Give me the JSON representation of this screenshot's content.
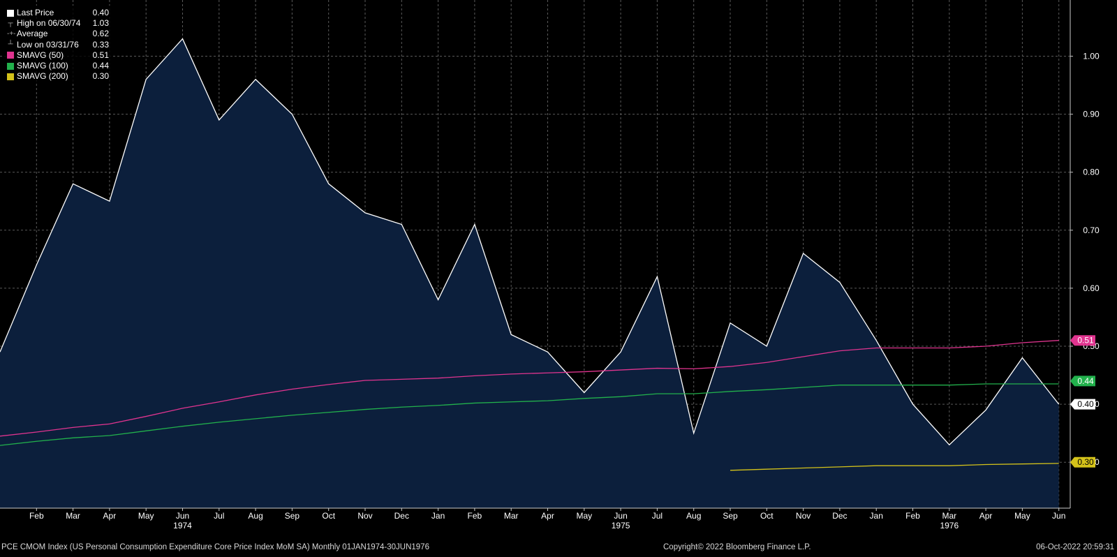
{
  "chart_data": {
    "type": "area",
    "title": "",
    "xlabel": "",
    "ylabel": "",
    "ylim": [
      0.2,
      1.1
    ],
    "yticks": [
      "1.00",
      "0.90",
      "0.80",
      "0.70",
      "0.60",
      "0.50",
      "0.40",
      "0.30"
    ],
    "grid": true,
    "legend_placement": "top-left",
    "x": [
      "1974-01",
      "1974-02",
      "1974-03",
      "1974-04",
      "1974-05",
      "1974-06",
      "1974-07",
      "1974-08",
      "1974-09",
      "1974-10",
      "1974-11",
      "1974-12",
      "1975-01",
      "1975-02",
      "1975-03",
      "1975-04",
      "1975-05",
      "1975-06",
      "1975-07",
      "1975-08",
      "1975-09",
      "1975-10",
      "1975-11",
      "1975-12",
      "1976-01",
      "1976-02",
      "1976-03",
      "1976-04",
      "1976-05",
      "1976-06"
    ],
    "month_labels": [
      "Feb",
      "Mar",
      "Apr",
      "May",
      "Jun",
      "Jul",
      "Aug",
      "Sep",
      "Oct",
      "Nov",
      "Dec",
      "Jan",
      "Feb",
      "Mar",
      "Apr",
      "May",
      "Jun",
      "Jul",
      "Aug",
      "Sep",
      "Oct",
      "Nov",
      "Dec",
      "Jan",
      "Feb",
      "Mar",
      "Apr",
      "May",
      "Jun"
    ],
    "year_labels": [
      {
        "label": "1974",
        "under_month": "1974-06"
      },
      {
        "label": "1975",
        "under_month": "1975-06"
      },
      {
        "label": "1976",
        "under_month": "1976-03"
      }
    ],
    "series": [
      {
        "name": "Last Price",
        "style": "area",
        "color": "#ffffff",
        "fill": "#0c1f3c",
        "values": [
          0.49,
          0.64,
          0.78,
          0.75,
          0.96,
          1.03,
          0.89,
          0.96,
          0.9,
          0.78,
          0.73,
          0.71,
          0.58,
          0.71,
          0.52,
          0.49,
          0.42,
          0.49,
          0.62,
          0.35,
          0.54,
          0.5,
          0.66,
          0.61,
          0.51,
          0.4,
          0.33,
          0.39,
          0.48,
          0.4
        ]
      },
      {
        "name": "SMAVG (50)",
        "style": "line",
        "color": "#e0348f",
        "values": [
          0.345,
          0.352,
          0.36,
          0.366,
          0.379,
          0.393,
          0.404,
          0.416,
          0.426,
          0.434,
          0.441,
          0.443,
          0.445,
          0.449,
          0.452,
          0.454,
          0.456,
          0.459,
          0.462,
          0.461,
          0.465,
          0.472,
          0.482,
          0.492,
          0.497,
          0.497,
          0.497,
          0.5,
          0.506,
          0.51
        ]
      },
      {
        "name": "SMAVG (100)",
        "style": "line",
        "color": "#22b14c",
        "values": [
          0.329,
          0.336,
          0.342,
          0.346,
          0.354,
          0.362,
          0.369,
          0.375,
          0.381,
          0.386,
          0.391,
          0.395,
          0.398,
          0.402,
          0.404,
          0.406,
          0.41,
          0.413,
          0.418,
          0.418,
          0.422,
          0.425,
          0.429,
          0.433,
          0.433,
          0.433,
          0.433,
          0.435,
          0.435,
          0.435
        ]
      },
      {
        "name": "SMAVG (200)",
        "style": "line",
        "color": "#d4c21a",
        "values": [
          null,
          null,
          null,
          null,
          null,
          null,
          null,
          null,
          null,
          null,
          null,
          null,
          null,
          null,
          null,
          null,
          null,
          null,
          null,
          null,
          0.286,
          0.288,
          0.29,
          0.292,
          0.294,
          0.294,
          0.294,
          0.296,
          0.297,
          0.298
        ]
      }
    ],
    "axis_badges": [
      {
        "label": "0.51",
        "color": "#e0348f",
        "text_color": "#ffffff",
        "value": 0.51
      },
      {
        "label": "0.44",
        "color": "#22b14c",
        "text_color": "#ffffff",
        "value": 0.44
      },
      {
        "label": "0.40",
        "color": "#ffffff",
        "text_color": "#000000",
        "value": 0.4
      },
      {
        "label": "0.30",
        "color": "#d4c21a",
        "text_color": "#000000",
        "value": 0.3
      }
    ]
  },
  "legend": {
    "items": [
      {
        "label": "Last Price",
        "value": "0.40",
        "marker": "square",
        "color": "#ffffff"
      },
      {
        "label": "High on 06/30/74",
        "value": "1.03",
        "marker": "high-glyph",
        "color": "#aaaaaa"
      },
      {
        "label": "Average",
        "value": "0.62",
        "marker": "average-glyph",
        "color": "#aaaaaa"
      },
      {
        "label": "Low on 03/31/76",
        "value": "0.33",
        "marker": "low-glyph",
        "color": "#aaaaaa"
      },
      {
        "label": "SMAVG (50)",
        "value": "0.51",
        "marker": "square",
        "color": "#e0348f"
      },
      {
        "label": "SMAVG (100)",
        "value": "0.44",
        "marker": "square",
        "color": "#22b14c"
      },
      {
        "label": "SMAVG (200)",
        "value": "0.30",
        "marker": "square",
        "color": "#d4c21a"
      }
    ]
  },
  "footer": {
    "left": "PCE CMOM Index (US Personal Consumption Expenditure Core Price Index MoM SA)  Monthly 01JAN1974-30JUN1976",
    "center": "Copyright© 2022 Bloomberg Finance L.P.",
    "right": "06-Oct-2022 20:59:31"
  }
}
